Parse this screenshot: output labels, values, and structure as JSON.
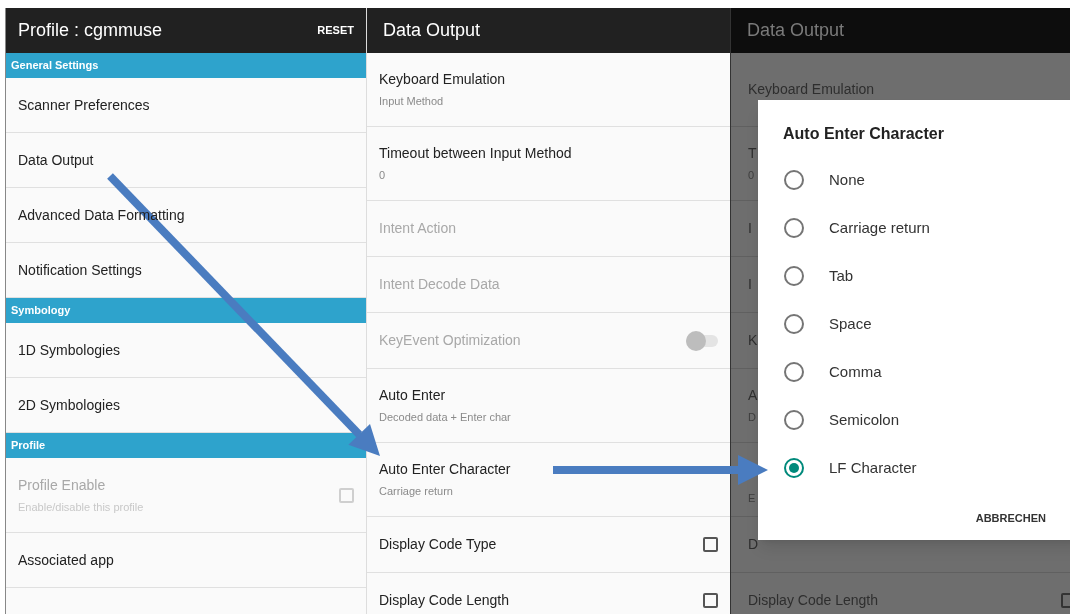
{
  "profile_screen": {
    "title": "Profile : cgmmuse",
    "action": "RESET",
    "sections": [
      {
        "header": "General Settings",
        "items": [
          {
            "title": "Scanner Preferences",
            "kind": "plain",
            "disabled": false
          },
          {
            "title": "Data Output",
            "kind": "plain",
            "disabled": false
          },
          {
            "title": "Advanced Data Formatting",
            "kind": "plain",
            "disabled": false
          },
          {
            "title": "Notification Settings",
            "kind": "plain",
            "disabled": false
          }
        ]
      },
      {
        "header": "Symbology",
        "items": [
          {
            "title": "1D Symbologies",
            "kind": "plain",
            "disabled": false
          },
          {
            "title": "2D Symbologies",
            "kind": "plain",
            "disabled": false
          }
        ]
      },
      {
        "header": "Profile",
        "items": [
          {
            "title": "Profile Enable",
            "subtitle": "Enable/disable this profile",
            "kind": "checkbox",
            "checked": false,
            "disabled": true
          },
          {
            "title": "Associated app",
            "kind": "plain",
            "disabled": false
          }
        ]
      }
    ]
  },
  "data_output_screen": {
    "title": "Data Output",
    "items": [
      {
        "title": "Keyboard Emulation",
        "subtitle": "Input Method",
        "kind": "plain",
        "disabled": false
      },
      {
        "title": "Timeout between Input Method",
        "subtitle": "0",
        "kind": "plain",
        "disabled": false
      },
      {
        "title": "Intent Action",
        "kind": "plain",
        "disabled": true
      },
      {
        "title": "Intent Decode Data",
        "kind": "plain",
        "disabled": true
      },
      {
        "title": "KeyEvent Optimization",
        "kind": "switch",
        "on": false,
        "disabled": true
      },
      {
        "title": "Auto Enter",
        "subtitle": "Decoded data + Enter char",
        "kind": "plain",
        "disabled": false
      },
      {
        "title": "Auto Enter Character",
        "subtitle": "Carriage return",
        "kind": "plain",
        "disabled": false
      },
      {
        "title": "Display Code Type",
        "kind": "checkbox",
        "checked": false,
        "disabled": false
      },
      {
        "title": "Display Code Length",
        "kind": "checkbox",
        "checked": false,
        "disabled": false
      }
    ]
  },
  "dialog_screen": {
    "title": "Data Output",
    "background_rows": [
      {
        "title": "Keyboard Emulation",
        "kind": "two_line"
      },
      {
        "title": "T",
        "subtitle": "0",
        "kind": "two_line"
      },
      {
        "title": "I",
        "kind": "one_line"
      },
      {
        "title": "I",
        "kind": "one_line"
      },
      {
        "title": "K",
        "kind": "one_line"
      },
      {
        "title": "A",
        "subtitle": "D",
        "kind": "two_line"
      },
      {
        "subtitle": "E",
        "kind": "two_line"
      },
      {
        "title": "D",
        "kind": "one_line"
      },
      {
        "title": "Display Code Length",
        "kind": "checkbox",
        "checked": false
      }
    ],
    "dialog": {
      "title": "Auto Enter Character",
      "options": [
        {
          "label": "None",
          "selected": false
        },
        {
          "label": "Carriage return",
          "selected": false
        },
        {
          "label": "Tab",
          "selected": false
        },
        {
          "label": "Space",
          "selected": false
        },
        {
          "label": "Comma",
          "selected": false
        },
        {
          "label": "Semicolon",
          "selected": false
        },
        {
          "label": "LF Character",
          "selected": true
        }
      ],
      "button": "ABBRECHEN"
    }
  }
}
